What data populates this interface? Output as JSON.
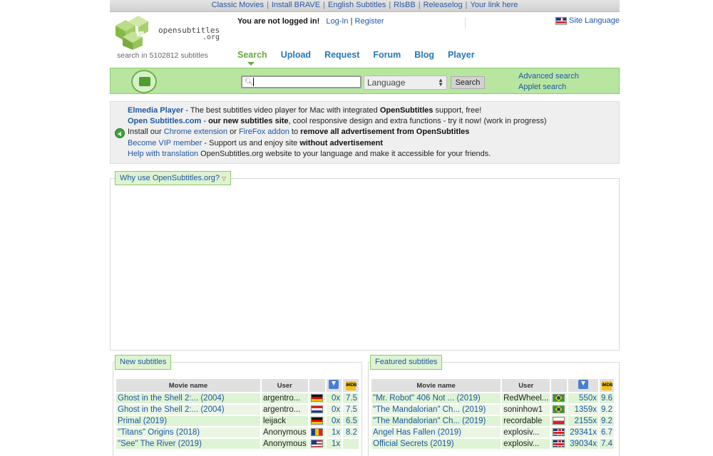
{
  "topstrip": {
    "links": [
      "Classic Movies",
      "Install BRAVE",
      "English Subtitles",
      "RlsBB",
      "Releaselog",
      "Your link here"
    ]
  },
  "header": {
    "logo_text": "opensubtitles",
    "logo_org": ".org",
    "search_count": "search in 5102812 subtitles",
    "not_logged": "You are not logged in!",
    "login": "Log-In",
    "login_sep": "|",
    "register": "Register",
    "site_language": "Site Language"
  },
  "nav": {
    "items": [
      "Search",
      "Upload",
      "Request",
      "Forum",
      "Blog",
      "Player"
    ]
  },
  "searchbar": {
    "input_value": "",
    "language_select": "Language",
    "search_button": "Search",
    "advanced": "Advanced search",
    "applet": "Applet search"
  },
  "promo": {
    "l1_link": "Elmedia Player",
    "l1_a": " - The best subtitles video player for Mac with integrated ",
    "l1_b": "OpenSubtitles",
    "l1_c": " support, free!",
    "l2_link": "Open Subtitles.com",
    "l2_a": " - ",
    "l2_b": "our new subtitles site",
    "l2_c": ", cool responsive design and extra functions - try it now! (work in progress)",
    "l3_a": "Install our ",
    "l3_link1": "Chrome extension",
    "l3_b": " or ",
    "l3_link2": "FireFox addon",
    "l3_c": " to ",
    "l3_d": "remove all advertisement from OpenSubtitles",
    "l4_link": "Become VIP member",
    "l4_a": " - Support us and enjoy site ",
    "l4_b": "without advertisement",
    "l5_link": "Help with translation",
    "l5_a": " OpenSubtitles.org website to your language and make it accessible for your friends."
  },
  "why": {
    "label": "Why use OpenSubtitles.org?"
  },
  "new_subs": {
    "title": "New subtitles",
    "headers": {
      "movie": "Movie name",
      "user": "User",
      "imdb": "IMDB"
    },
    "rows": [
      {
        "movie": "Ghost in the Shell 2:... (2004)",
        "user": "argentro...",
        "flag": "de",
        "dl": "0x",
        "rating": "7.5"
      },
      {
        "movie": "Ghost in the Shell 2:... (2004)",
        "user": "argentro...",
        "flag": "hr",
        "dl": "0x",
        "rating": "7.5"
      },
      {
        "movie": "Primal (2019)",
        "user": "leijack",
        "flag": "de",
        "dl": "0x",
        "rating": "6.5"
      },
      {
        "movie": "\"Titans\" Origins (2018)",
        "user": "Anonymous",
        "flag": "ro",
        "dl": "1x",
        "rating": "8.2"
      },
      {
        "movie": "\"See\" The River (2019)",
        "user": "Anonymous",
        "flag": "us",
        "dl": "1x",
        "rating": ""
      }
    ]
  },
  "featured_subs": {
    "title": "Featured subtitles",
    "headers": {
      "movie": "Movie name",
      "user": "User",
      "imdb": "IMDB"
    },
    "rows": [
      {
        "movie": "\"Mr. Robot\" 406 Not ... (2019)",
        "user": "RedWheel...",
        "flag": "br",
        "dl": "550x",
        "rating": "9.6"
      },
      {
        "movie": "\"The Mandalorian\" Ch... (2019)",
        "user": "soninhow1",
        "flag": "br",
        "dl": "1359x",
        "rating": "9.2"
      },
      {
        "movie": "\"The Mandalorian\" Ch... (2019)",
        "user": "recordable",
        "flag": "pl",
        "dl": "2155x",
        "rating": "9.2"
      },
      {
        "movie": "Angel Has Fallen (2019)",
        "user": "explosiv...",
        "flag": "gb",
        "dl": "29341x",
        "rating": "6.7"
      },
      {
        "movie": "Official Secrets (2019)",
        "user": "explosiv...",
        "flag": "gb",
        "dl": "39034x",
        "rating": "7.4"
      }
    ]
  }
}
